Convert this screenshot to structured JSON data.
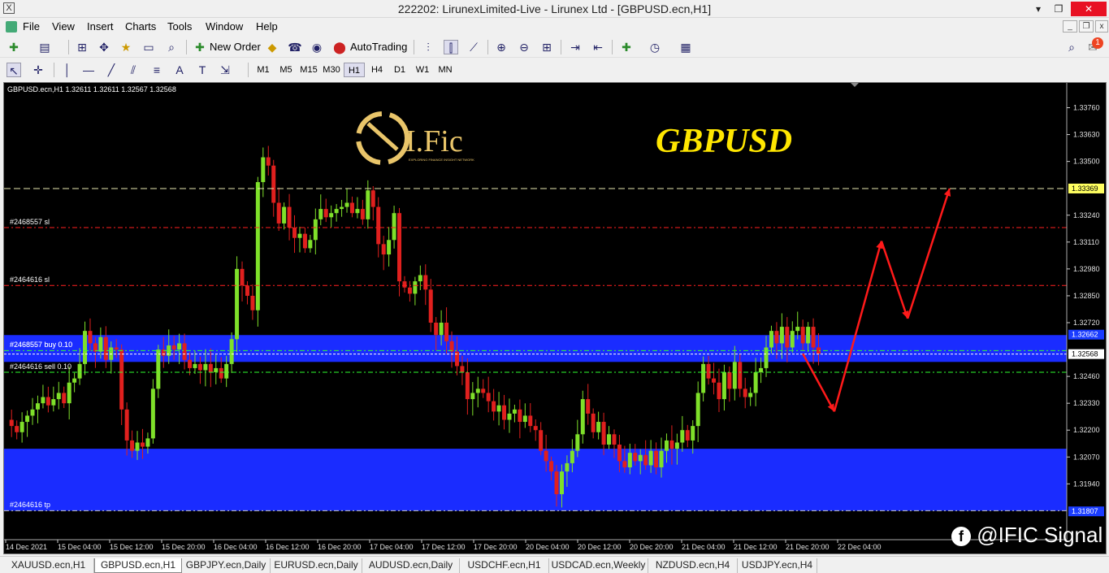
{
  "window": {
    "title": "222202: LirunexLimited-Live - Lirunex Ltd - [GBPUSD.ecn,H1]",
    "minimize": "▾",
    "restore": "❐",
    "close": "✕"
  },
  "menu": [
    "File",
    "View",
    "Insert",
    "Charts",
    "Tools",
    "Window",
    "Help"
  ],
  "toolbar": {
    "new_order": "New Order",
    "autotrading": "AutoTrading",
    "notifications": "1"
  },
  "timeframes": [
    "M1",
    "M5",
    "M15",
    "M30",
    "H1",
    "H4",
    "D1",
    "W1",
    "MN"
  ],
  "active_timeframe": "H1",
  "chart": {
    "header": "GBPUSD.ecn,H1  1.32611 1.32611 1.32567 1.32568",
    "brand": "GBPUSD",
    "logo_text": "I.Fic",
    "logo_tagline": "EXPLORING FINANCE INSIGHT NETWORK",
    "watermark": "@IFIC Signal",
    "orders": [
      {
        "label": "#2468557 sl",
        "price": 1.3318,
        "color": "#ff2020"
      },
      {
        "label": "#2464616 sl",
        "price": 1.329,
        "color": "#ff2020"
      },
      {
        "label": "#2468557 buy 0.10",
        "price": 1.32585,
        "color": "#30ff30"
      },
      {
        "label": "#2464616 sell 0.10",
        "price": 1.3248,
        "color": "#30ff30"
      },
      {
        "label": "#2464616 tp",
        "price": 1.3181,
        "color": "#cccccc"
      }
    ],
    "overlap_label": "#2468557 buy 0.10",
    "price_tags": [
      {
        "price": 1.33369,
        "label": "1.33369",
        "bg": "#ffff60",
        "fg": "#000"
      },
      {
        "price": 1.32662,
        "label": "1.32662",
        "bg": "#1a3cff",
        "fg": "#fff"
      },
      {
        "price": 1.32568,
        "label": "1.32568",
        "bg": "#ffffff",
        "fg": "#000"
      },
      {
        "price": 1.31807,
        "label": "1.31807",
        "bg": "#1a3cff",
        "fg": "#fff"
      }
    ]
  },
  "chart_data": {
    "type": "candlestick",
    "symbol": "GBPUSD.ecn",
    "timeframe": "H1",
    "ylim": [
      1.3167,
      1.3388
    ],
    "y_ticks": [
      "1.33760",
      "1.33630",
      "1.33500",
      "1.33240",
      "1.33110",
      "1.32980",
      "1.32850",
      "1.32720",
      "1.32460",
      "1.32330",
      "1.32200",
      "1.32070",
      "1.31940"
    ],
    "x_ticks": [
      "14 Dec 2021",
      "15 Dec 04:00",
      "15 Dec 12:00",
      "15 Dec 20:00",
      "16 Dec 04:00",
      "16 Dec 12:00",
      "16 Dec 20:00",
      "17 Dec 04:00",
      "17 Dec 12:00",
      "17 Dec 20:00",
      "20 Dec 04:00",
      "20 Dec 12:00",
      "20 Dec 20:00",
      "21 Dec 04:00",
      "21 Dec 12:00",
      "21 Dec 20:00",
      "22 Dec 04:00"
    ],
    "zones": [
      {
        "from": 1.3253,
        "to": 1.3266,
        "color": "#1a2cff"
      },
      {
        "from": 1.3181,
        "to": 1.3211,
        "color": "#1a2cff"
      }
    ],
    "resistance": 1.33369,
    "close_price": 1.32568,
    "bull_color": "#7fe02a",
    "bear_color": "#e0201e",
    "closes": [
      1.3222,
      1.3219,
      1.3224,
      1.3227,
      1.323,
      1.3233,
      1.3236,
      1.3232,
      1.3235,
      1.3238,
      1.3233,
      1.3243,
      1.3245,
      1.3252,
      1.3268,
      1.3262,
      1.3258,
      1.3265,
      1.3254,
      1.326,
      1.3259,
      1.323,
      1.3215,
      1.321,
      1.3214,
      1.3212,
      1.3216,
      1.324,
      1.3259,
      1.3256,
      1.3261,
      1.3259,
      1.3262,
      1.3254,
      1.325,
      1.3252,
      1.3249,
      1.3252,
      1.3248,
      1.325,
      1.3245,
      1.3252,
      1.3264,
      1.3298,
      1.329,
      1.3285,
      1.3278,
      1.334,
      1.3352,
      1.3348,
      1.333,
      1.332,
      1.3328,
      1.3318,
      1.3313,
      1.3315,
      1.3308,
      1.3312,
      1.3322,
      1.3327,
      1.3323,
      1.3325,
      1.3327,
      1.3328,
      1.333,
      1.3325,
      1.3327,
      1.3322,
      1.3336,
      1.3328,
      1.331,
      1.3305,
      1.3312,
      1.3325,
      1.3292,
      1.3289,
      1.3286,
      1.3292,
      1.3295,
      1.3288,
      1.3272,
      1.3266,
      1.3272,
      1.3263,
      1.3258,
      1.3251,
      1.3248,
      1.3235,
      1.3238,
      1.324,
      1.3238,
      1.3234,
      1.3229,
      1.3232,
      1.3225,
      1.3228,
      1.323,
      1.3224,
      1.3227,
      1.3222,
      1.322,
      1.321,
      1.3205,
      1.32,
      1.3189,
      1.32,
      1.3204,
      1.321,
      1.3218,
      1.3235,
      1.3228,
      1.3219,
      1.3224,
      1.3213,
      1.3218,
      1.3213,
      1.3205,
      1.3202,
      1.3209,
      1.3205,
      1.3208,
      1.3203,
      1.321,
      1.3202,
      1.321,
      1.3215,
      1.3211,
      1.3214,
      1.322,
      1.3215,
      1.3222,
      1.3238,
      1.3252,
      1.3245,
      1.3243,
      1.3235,
      1.3248,
      1.324,
      1.3253,
      1.324,
      1.3236,
      1.3238,
      1.3248,
      1.325,
      1.326,
      1.3268,
      1.3262,
      1.327,
      1.326,
      1.3268,
      1.327,
      1.3262,
      1.327,
      1.326,
      1.3257
    ],
    "projection": [
      {
        "i": 151,
        "price": 1.3257
      },
      {
        "i": 157,
        "price": 1.3229
      },
      {
        "i": 166,
        "price": 1.33115
      },
      {
        "i": 171,
        "price": 1.3274
      },
      {
        "i": 179,
        "price": 1.33369
      }
    ],
    "projection_color": "#ff1a1a"
  },
  "tabs": [
    "XAUUSD.ecn,H1",
    "GBPUSD.ecn,H1",
    "GBPJPY.ecn,Daily",
    "EURUSD.ecn,Daily",
    "AUDUSD.ecn,Daily",
    "USDCHF.ecn,H1",
    "USDCAD.ecn,Weekly",
    "NZDUSD.ecn,H4",
    "USDJPY.ecn,H4"
  ],
  "active_tab": "GBPUSD.ecn,H1"
}
